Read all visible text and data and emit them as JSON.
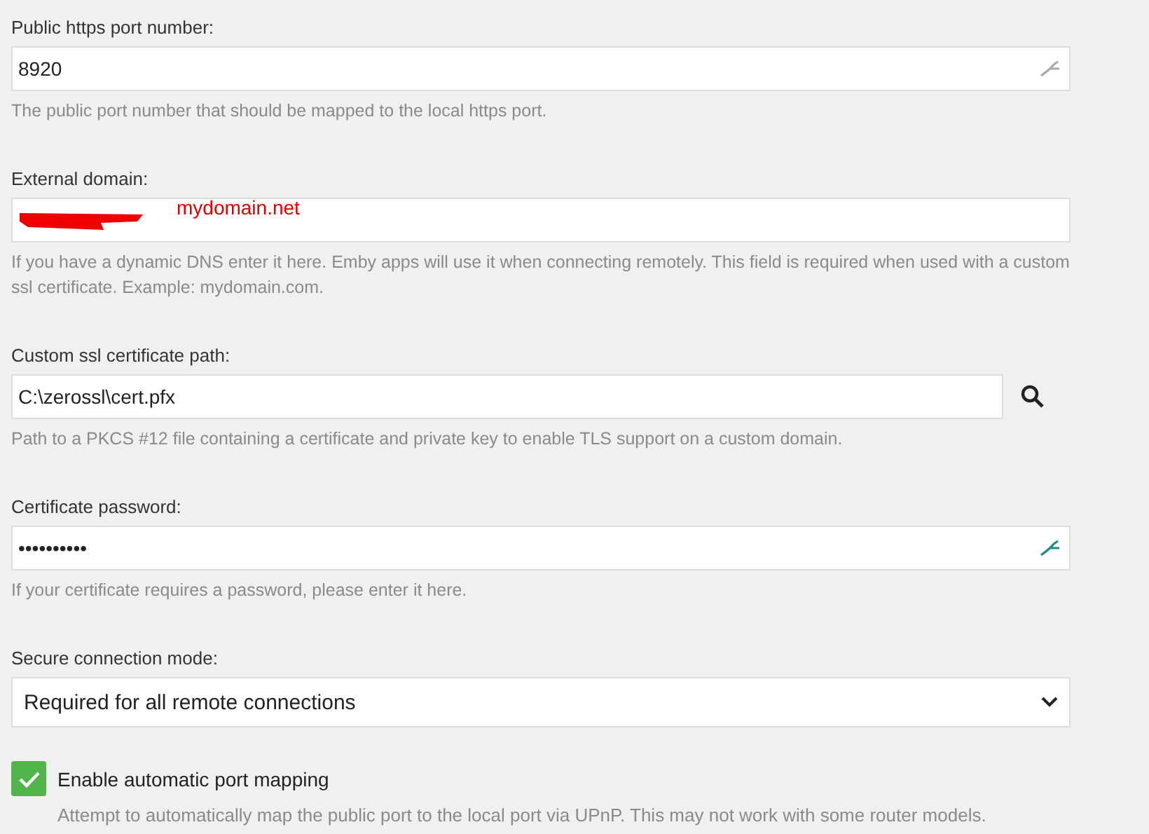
{
  "fields": [
    {
      "kind": "text",
      "label": "Public https port number:",
      "value": "8920",
      "help": "The public port number that should be mapped to the local https port.",
      "autofill_icon": true,
      "autofill_active": false
    },
    {
      "kind": "text",
      "label": "External domain:",
      "redacted": true,
      "annotation": "mydomain.net",
      "help": "If you have a dynamic DNS enter it here. Emby apps will use it when connecting remotely. This field is required when used with a custom ssl certificate. Example: mydomain.com."
    },
    {
      "kind": "file",
      "label": "Custom ssl certificate path:",
      "value": "C:\\zerossl\\cert.pfx",
      "help": "Path to a PKCS #12 file containing a certificate and private key to enable TLS support on a custom domain."
    },
    {
      "kind": "text",
      "label": "Certificate password:",
      "value": "••••••••••",
      "help": "If your certificate requires a password, please enter it here.",
      "autofill_icon": true,
      "autofill_active": true
    },
    {
      "kind": "select",
      "label": "Secure connection mode:",
      "value": "Required for all remote connections"
    }
  ],
  "checkbox": {
    "label": "Enable automatic port mapping",
    "checked": true,
    "help": "Attempt to automatically map the public port to the local port via UPnP. This may not work with some router models."
  }
}
